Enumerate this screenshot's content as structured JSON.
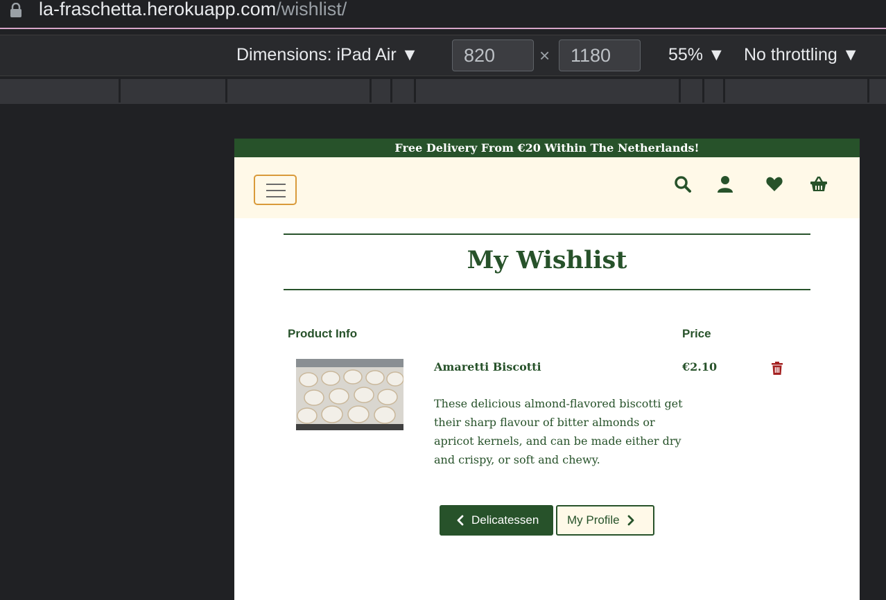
{
  "browser": {
    "url_domain": "la-fraschetta.herokuapp.com",
    "url_path": "/wishlist/"
  },
  "devtools": {
    "dimensions_label": "Dimensions: iPad Air ▼",
    "width_value": "820",
    "height_value": "1180",
    "times_symbol": "×",
    "zoom_label": "55% ▼",
    "throttling_label": "No throttling ▼"
  },
  "site": {
    "banner_text": "Free Delivery From €20 Within The Netherlands!",
    "page_title": "My Wishlist",
    "table": {
      "headers": {
        "product_info": "Product Info",
        "price": "Price"
      },
      "rows": [
        {
          "name": "Amaretti Biscotti",
          "description": "These delicious almond-flavored biscotti get their sharp flavour of bitter almonds or apricot kernels, and can be made either dry and crispy, or soft and chewy.",
          "price": "€2.10"
        }
      ]
    },
    "buttons": {
      "back_label": "Delicatessen",
      "profile_label": "My Profile"
    },
    "colors": {
      "brand_green": "#27522a",
      "navbar_cream": "#fff9e8",
      "toggler_orange": "#d99a3a",
      "delete_red": "#a42121"
    },
    "icons": [
      "search-icon",
      "user-icon",
      "heart-icon",
      "basket-icon",
      "trash-icon",
      "chevron-left-icon",
      "chevron-right-icon"
    ]
  }
}
